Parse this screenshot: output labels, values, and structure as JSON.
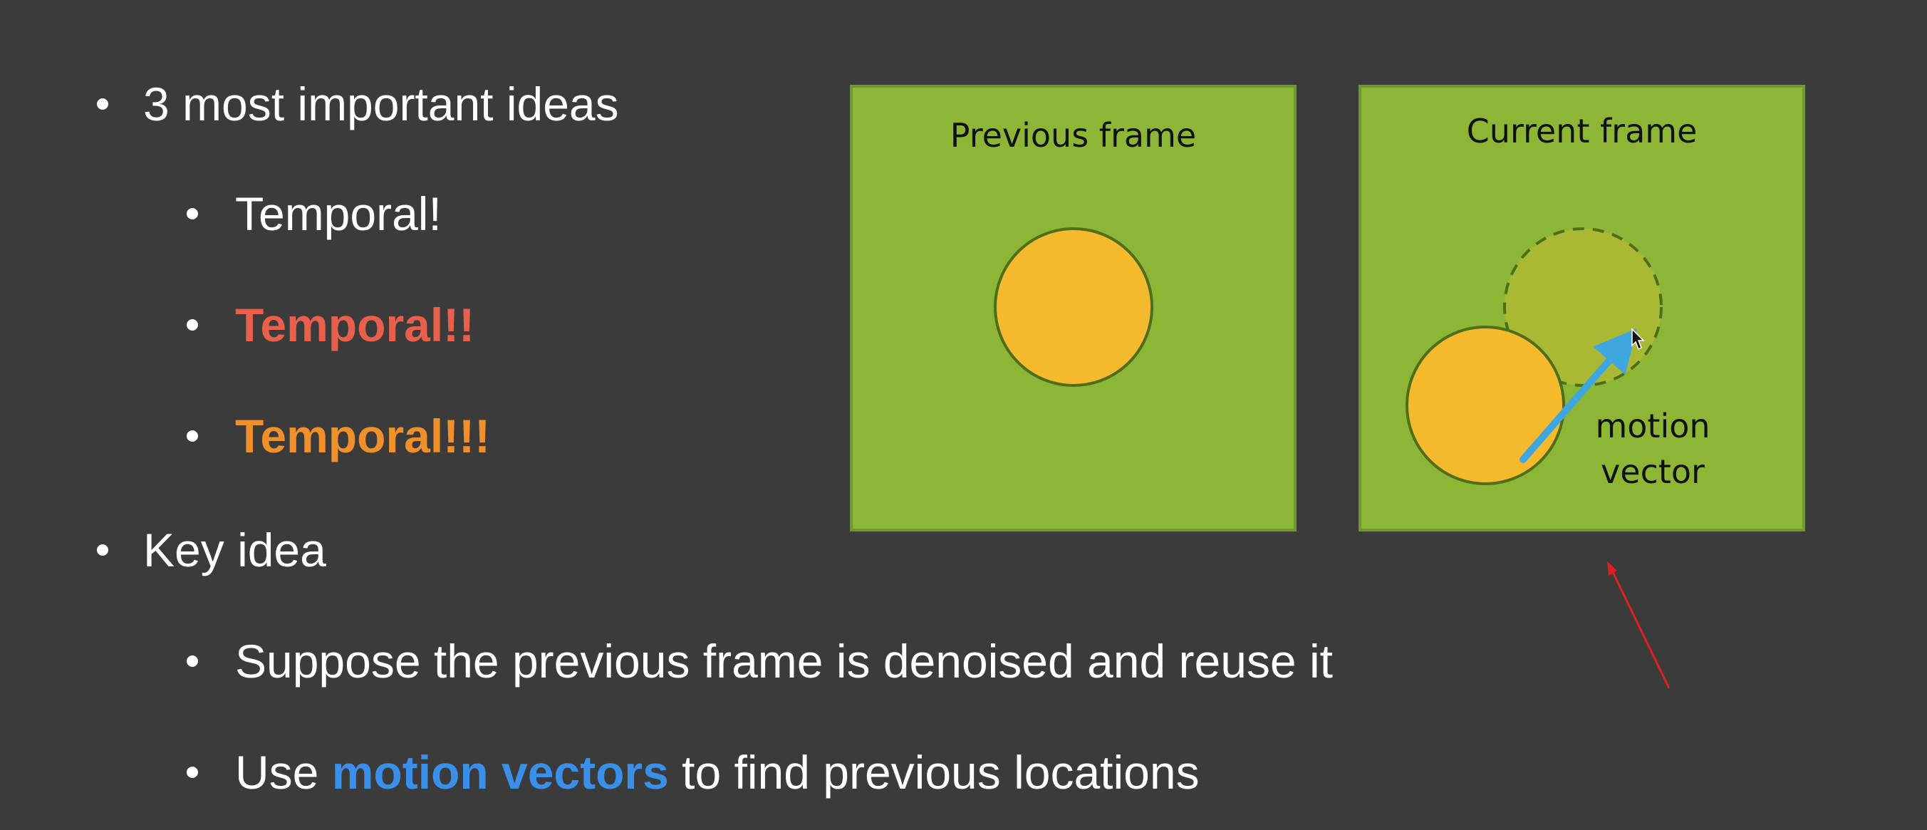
{
  "bullets": {
    "b1": "3 most important ideas",
    "b2": "Temporal!",
    "b3": "Temporal!!",
    "b4": "Temporal!!!",
    "b5": "Key idea",
    "b6": "Suppose the previous frame is denoised and reuse it",
    "b7_pre": "Use ",
    "b7_highlight": "motion vectors",
    "b7_post": " to find previous locations"
  },
  "diagram": {
    "previous_frame_title": "Previous frame",
    "current_frame_title": "Current frame",
    "motion_label_line1": "motion",
    "motion_label_line2": "vector"
  },
  "colors": {
    "background": "#3b3b3b",
    "frame_green": "#8db637",
    "circle_orange": "#f5b92e",
    "temporal2": "#e8604c",
    "temporal3": "#f0902a",
    "motion_vectors_blue": "#3a8fe8",
    "arrow_blue": "#3fa7e0",
    "annotation_red": "#e02020"
  },
  "icons": {
    "cursor": "mouse-pointer-icon",
    "annotation": "red-arrow-annotation"
  }
}
